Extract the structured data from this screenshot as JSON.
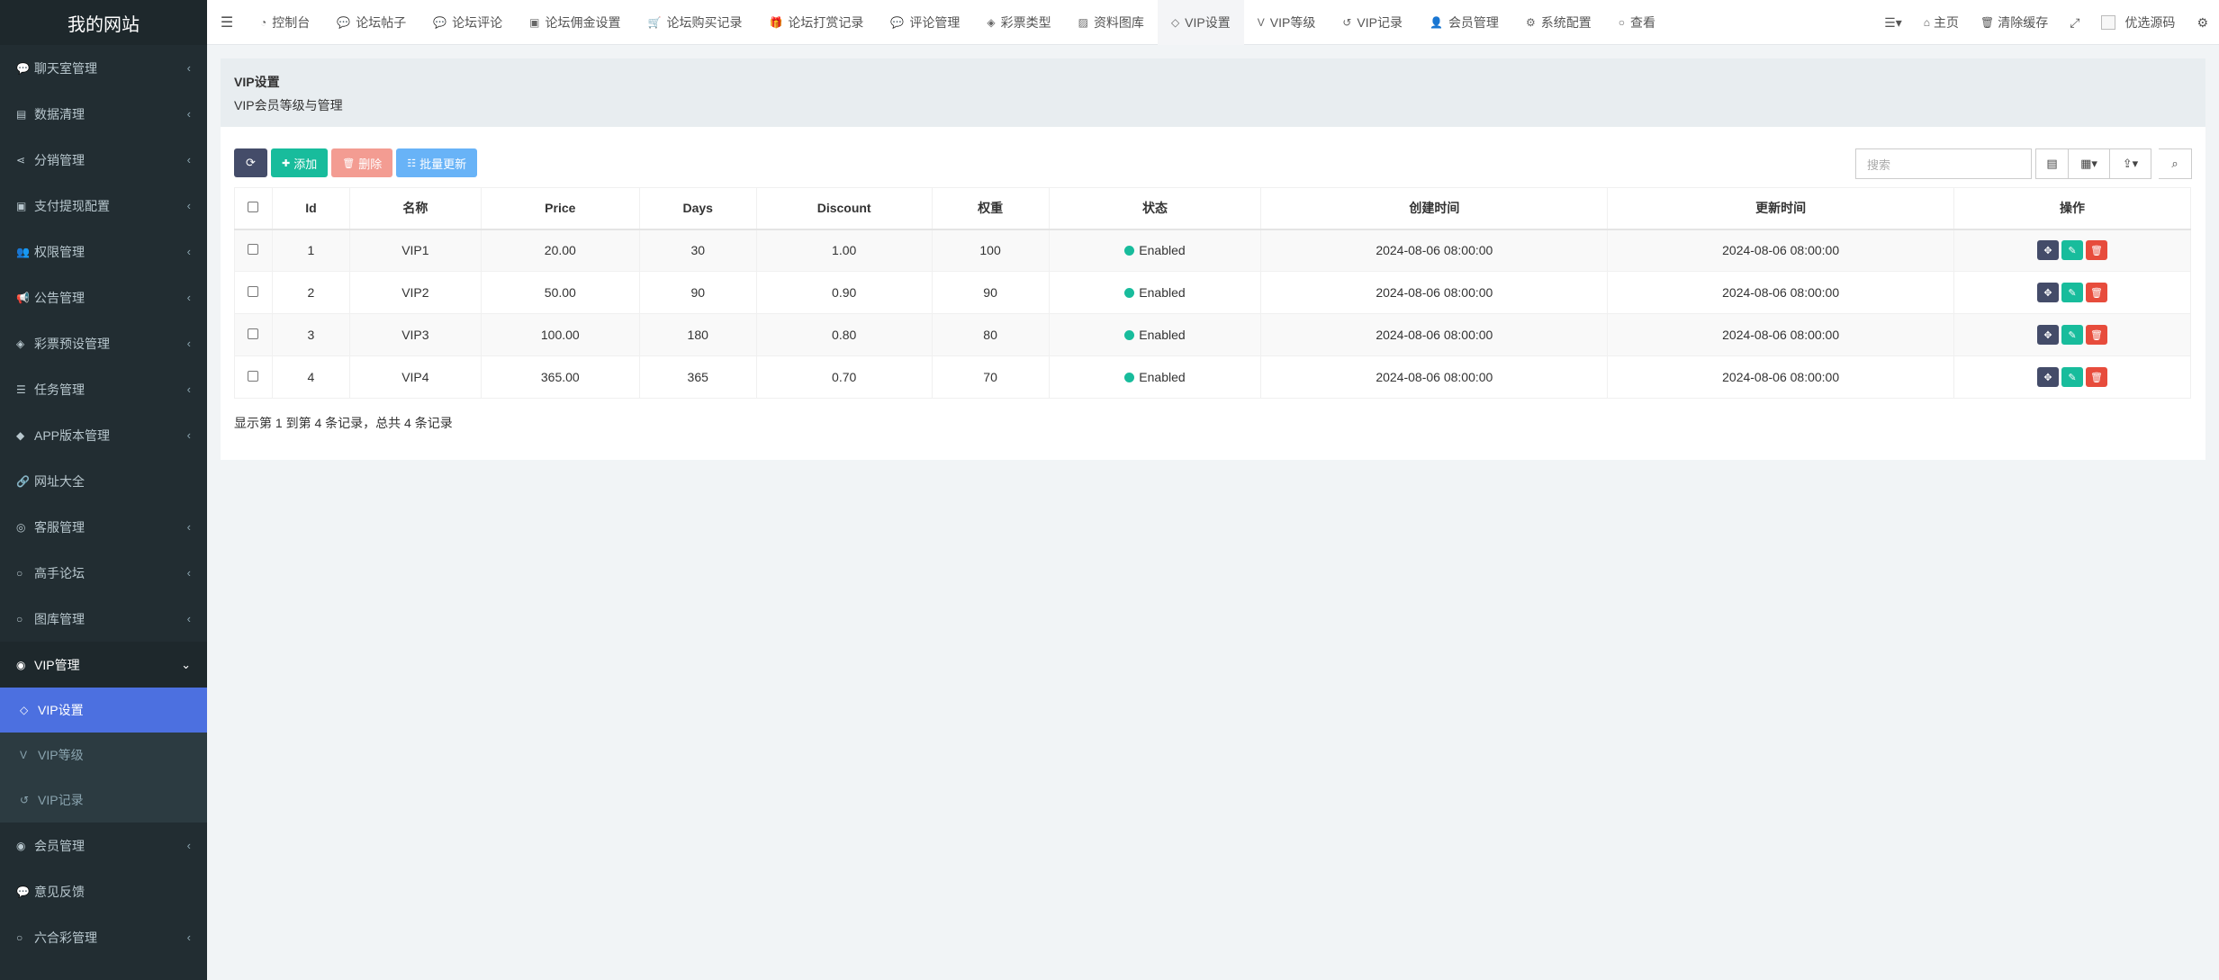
{
  "site_title": "我的网站",
  "sidebar": {
    "items": [
      {
        "icon": "comments-icon",
        "glyph": "💬",
        "label": "聊天室管理"
      },
      {
        "icon": "database-icon",
        "glyph": "▤",
        "label": "数据清理"
      },
      {
        "icon": "share-icon",
        "glyph": "⋖",
        "label": "分销管理"
      },
      {
        "icon": "money-icon",
        "glyph": "▣",
        "label": "支付提现配置"
      },
      {
        "icon": "users-icon",
        "glyph": "👥",
        "label": "权限管理"
      },
      {
        "icon": "bullhorn-icon",
        "glyph": "📢",
        "label": "公告管理"
      },
      {
        "icon": "ticket-icon",
        "glyph": "◈",
        "label": "彩票预设管理"
      },
      {
        "icon": "tasks-icon",
        "glyph": "☰",
        "label": "任务管理"
      },
      {
        "icon": "android-icon",
        "glyph": "◆",
        "label": "APP版本管理"
      },
      {
        "icon": "link-icon",
        "glyph": "🔗",
        "label": "网址大全"
      },
      {
        "icon": "headset-icon",
        "glyph": "◎",
        "label": "客服管理"
      },
      {
        "icon": "circle-icon",
        "glyph": "○",
        "label": "高手论坛"
      },
      {
        "icon": "circle-icon",
        "glyph": "○",
        "label": "图库管理"
      }
    ],
    "vip_group": {
      "icon": "cat-icon",
      "glyph": "◉",
      "label": "VIP管理"
    },
    "vip_sub": [
      {
        "icon": "diamond-icon",
        "glyph": "◇",
        "label": "VIP设置"
      },
      {
        "icon": "vimeo-icon",
        "glyph": "V",
        "label": "VIP等级"
      },
      {
        "icon": "history-icon",
        "glyph": "↺",
        "label": "VIP记录"
      }
    ],
    "after": [
      {
        "icon": "user-circle-icon",
        "glyph": "◉",
        "label": "会员管理",
        "arrow": true
      },
      {
        "icon": "comment-icon",
        "glyph": "💬",
        "label": "意见反馈",
        "arrow": false
      },
      {
        "icon": "circle-icon",
        "glyph": "○",
        "label": "六合彩管理",
        "arrow": true
      }
    ]
  },
  "navbar": {
    "tabs": [
      {
        "icon": "dashboard-icon",
        "glyph": "◔",
        "label": "控制台"
      },
      {
        "icon": "comment-icon",
        "glyph": "💬",
        "label": "论坛帖子"
      },
      {
        "icon": "comments-icon",
        "glyph": "💬",
        "label": "论坛评论"
      },
      {
        "icon": "money-icon",
        "glyph": "▣",
        "label": "论坛佣金设置"
      },
      {
        "icon": "cart-icon",
        "glyph": "🛒",
        "label": "论坛购买记录"
      },
      {
        "icon": "gift-icon",
        "glyph": "🎁",
        "label": "论坛打赏记录"
      },
      {
        "icon": "comment-icon",
        "glyph": "💬",
        "label": "评论管理"
      },
      {
        "icon": "ticket-icon",
        "glyph": "◈",
        "label": "彩票类型"
      },
      {
        "icon": "image-icon",
        "glyph": "▨",
        "label": "资料图库"
      },
      {
        "icon": "diamond-icon",
        "glyph": "◇",
        "label": "VIP设置"
      },
      {
        "icon": "vimeo-icon",
        "glyph": "V",
        "label": "VIP等级"
      },
      {
        "icon": "history-icon",
        "glyph": "↺",
        "label": "VIP记录"
      },
      {
        "icon": "user-icon",
        "glyph": "👤",
        "label": "会员管理"
      },
      {
        "icon": "gear-icon",
        "glyph": "⚙",
        "label": "系统配置"
      },
      {
        "icon": "circle-icon",
        "glyph": "○",
        "label": "查看"
      }
    ],
    "right": {
      "home": "主页",
      "clear_cache": "清除缓存",
      "user": "优选源码"
    }
  },
  "panel": {
    "title": "VIP设置",
    "subtitle": "VIP会员等级与管理"
  },
  "toolbar": {
    "add": "添加",
    "delete": "删除",
    "batch": "批量更新"
  },
  "search": {
    "placeholder": "搜索"
  },
  "table": {
    "columns": [
      "Id",
      "名称",
      "Price",
      "Days",
      "Discount",
      "权重",
      "状态",
      "创建时间",
      "更新时间",
      "操作"
    ],
    "rows": [
      {
        "id": "1",
        "name": "VIP1",
        "price": "20.00",
        "days": "30",
        "discount": "1.00",
        "weight": "100",
        "status": "Enabled",
        "created": "2024-08-06 08:00:00",
        "updated": "2024-08-06 08:00:00"
      },
      {
        "id": "2",
        "name": "VIP2",
        "price": "50.00",
        "days": "90",
        "discount": "0.90",
        "weight": "90",
        "status": "Enabled",
        "created": "2024-08-06 08:00:00",
        "updated": "2024-08-06 08:00:00"
      },
      {
        "id": "3",
        "name": "VIP3",
        "price": "100.00",
        "days": "180",
        "discount": "0.80",
        "weight": "80",
        "status": "Enabled",
        "created": "2024-08-06 08:00:00",
        "updated": "2024-08-06 08:00:00"
      },
      {
        "id": "4",
        "name": "VIP4",
        "price": "365.00",
        "days": "365",
        "discount": "0.70",
        "weight": "70",
        "status": "Enabled",
        "created": "2024-08-06 08:00:00",
        "updated": "2024-08-06 08:00:00"
      }
    ]
  },
  "pager": {
    "summary": "显示第 1 到第 4 条记录，总共 4 条记录"
  },
  "colors": {
    "accent": "#4c70e0",
    "success": "#18bc9c",
    "danger": "#e74c3c",
    "sidebar_bg": "#222d32"
  }
}
